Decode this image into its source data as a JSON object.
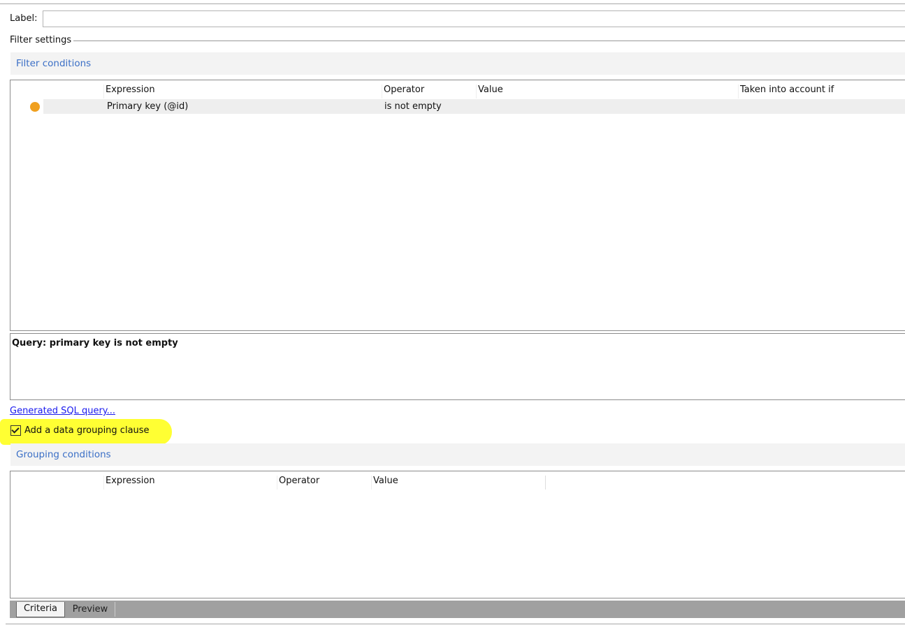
{
  "label": {
    "text": "Label:",
    "value": ""
  },
  "filter_settings": "Filter settings",
  "filter_conditions": {
    "title": "Filter conditions",
    "columns": [
      "Expression",
      "Operator",
      "Value",
      "Taken into account if"
    ],
    "rows": [
      {
        "status_color": "#f0a020",
        "expression": "Primary key (@id)",
        "operator": "is not empty",
        "value": "",
        "condition": ""
      }
    ]
  },
  "query_text": "Query: primary key is not empty",
  "sql_link": "Generated SQL query...",
  "grouping_checkbox": {
    "label": "Add a data grouping clause",
    "checked": true,
    "highlight_color": "#ffff33"
  },
  "grouping_conditions": {
    "title": "Grouping conditions",
    "columns": [
      "Expression",
      "Operator",
      "Value"
    ]
  },
  "tabs": [
    {
      "label": "Criteria",
      "active": true
    },
    {
      "label": "Preview",
      "active": false
    }
  ]
}
